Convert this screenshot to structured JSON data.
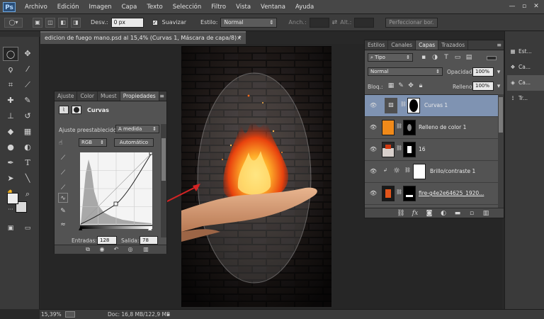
{
  "app": {
    "logo": "Ps"
  },
  "menu": [
    "Archivo",
    "Edición",
    "Imagen",
    "Capa",
    "Texto",
    "Selección",
    "Filtro",
    "Vista",
    "Ventana",
    "Ayuda"
  ],
  "window_controls": {
    "minimize": "—",
    "restore": "▫",
    "close": "✕"
  },
  "options_bar": {
    "desv_label": "Desv.:",
    "desv_value": "0 px",
    "suavizar_label": "Suavizar",
    "estilo_label": "Estilo:",
    "estilo_value": "Normal",
    "anch_label": "Anch.:",
    "alt_label": "Alt.:",
    "refine_label": "Perfeccionar bor."
  },
  "document": {
    "tab_title": "edicion de fuego mano.psd al 15,4% (Curvas 1, Máscara de capa/8) *",
    "close": "×"
  },
  "status": {
    "zoom": "15,39%",
    "doc_info": "Doc: 16,8 MB/122,9 MB"
  },
  "properties_panel": {
    "tabs": [
      "Ajuste",
      "Color",
      "Muest",
      "Propiedades"
    ],
    "active_tab": 3,
    "title": "Curvas",
    "preset_label": "Ajuste preestablecido:",
    "preset_value": "A medida",
    "channel_value": "RGB",
    "auto_label": "Automático",
    "input_label": "Entradas:",
    "input_value": "128",
    "output_label": "Salida:",
    "output_value": "78"
  },
  "layers_panel": {
    "tabs": [
      "Estilos",
      "Canales",
      "Capas",
      "Trazados"
    ],
    "active_tab": 2,
    "kind_label": "Tipo",
    "blend_mode": "Normal",
    "opacity_label": "Opacidad:",
    "opacity_value": "100%",
    "lock_label": "Bloq.:",
    "fill_label": "Relleno:",
    "fill_value": "100%",
    "layers": [
      {
        "name": "Curvas 1",
        "selected": true
      },
      {
        "name": "Relleno de color 1",
        "selected": false
      },
      {
        "name": "16",
        "selected": false
      },
      {
        "name": "Brillo/contraste 1",
        "selected": false
      },
      {
        "name": "fire-g4e2e64625_1920...",
        "selected": false
      }
    ]
  },
  "right_dock": {
    "items": [
      "Est...",
      "Ca...",
      "Ca...",
      "Tr..."
    ]
  },
  "colors": {
    "accent_selected": "#7f93b2",
    "fill_orange": "#f08a1a",
    "arrow_red": "#d42424"
  }
}
